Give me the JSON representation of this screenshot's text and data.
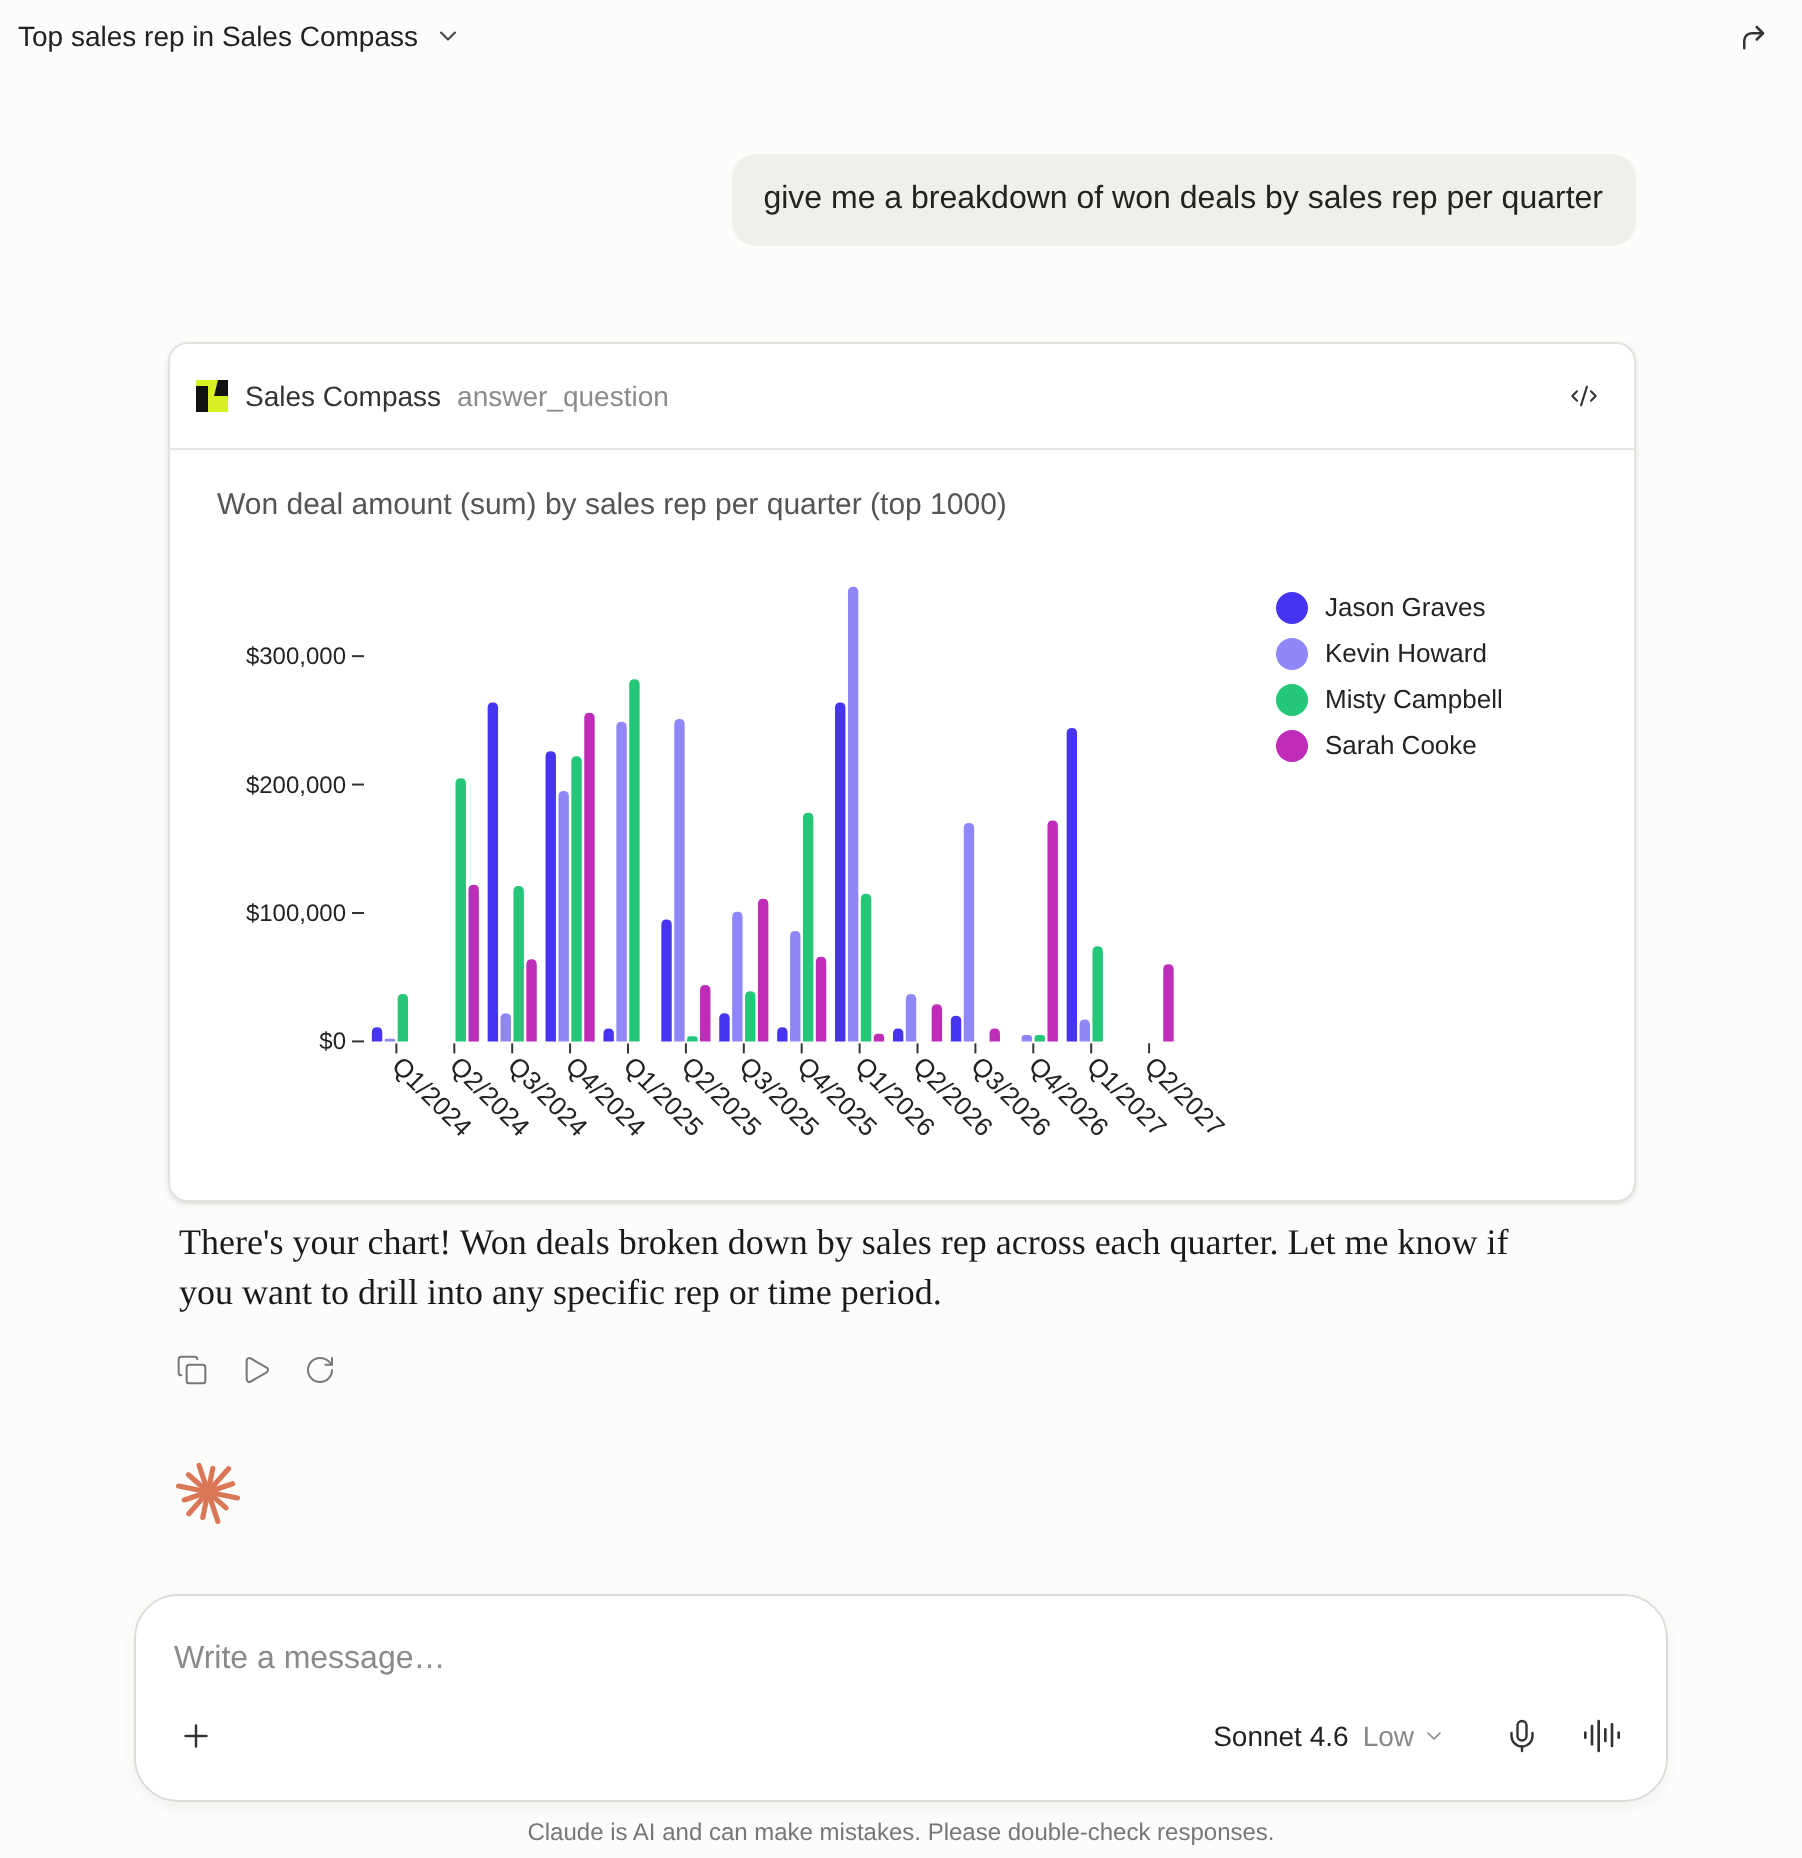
{
  "header": {
    "title": "Top sales rep in Sales Compass"
  },
  "user_message": {
    "text": "give me a breakdown of won deals by sales rep per quarter"
  },
  "tool_card": {
    "app_name": "Sales Compass",
    "tool_name": "answer_question",
    "chart_data": {
      "type": "bar",
      "title": "Won deal amount (sum) by sales rep per quarter (top 1000)",
      "categories": [
        "Q1/2024",
        "Q2/2024",
        "Q3/2024",
        "Q4/2024",
        "Q1/2025",
        "Q2/2025",
        "Q3/2025",
        "Q4/2025",
        "Q1/2026",
        "Q2/2026",
        "Q3/2026",
        "Q4/2026",
        "Q1/2027",
        "Q2/2027"
      ],
      "series": [
        {
          "name": "Jason Graves",
          "color": "#4634f0",
          "values": [
            11000,
            null,
            264000,
            226000,
            10000,
            95000,
            22000,
            11000,
            264000,
            10000,
            20000,
            null,
            244000,
            null
          ]
        },
        {
          "name": "Kevin Howard",
          "color": "#8f87f8",
          "values": [
            2000,
            null,
            22000,
            195000,
            249000,
            251000,
            101000,
            86000,
            354000,
            37000,
            170000,
            5000,
            17000,
            null
          ]
        },
        {
          "name": "Misty Campbell",
          "color": "#24c677",
          "values": [
            37000,
            205000,
            121000,
            222000,
            282000,
            4000,
            39000,
            178000,
            115000,
            null,
            null,
            5000,
            74000,
            null
          ]
        },
        {
          "name": "Sarah Cooke",
          "color": "#bf2cb7",
          "values": [
            null,
            122000,
            64000,
            256000,
            null,
            44000,
            111000,
            66000,
            6000,
            29000,
            10000,
            172000,
            null,
            60000
          ]
        }
      ],
      "stacked": false,
      "legend": "right",
      "ylim": [
        0,
        354000
      ],
      "yticks": [
        {
          "value": 0,
          "label": "$0"
        },
        {
          "value": 100000,
          "label": "$100,000"
        },
        {
          "value": 200000,
          "label": "$200,000"
        },
        {
          "value": 300000,
          "label": "$300,000"
        }
      ]
    }
  },
  "assistant_message": {
    "text": "There's your chart! Won deals broken down by sales rep across each quarter. Let me know if you want to drill into any specific rep or time period."
  },
  "composer": {
    "placeholder": "Write a message…",
    "model": "Sonnet 4.6",
    "effort": "Low"
  },
  "disclaimer": "Claude is AI and can make mistakes. Please double-check responses."
}
